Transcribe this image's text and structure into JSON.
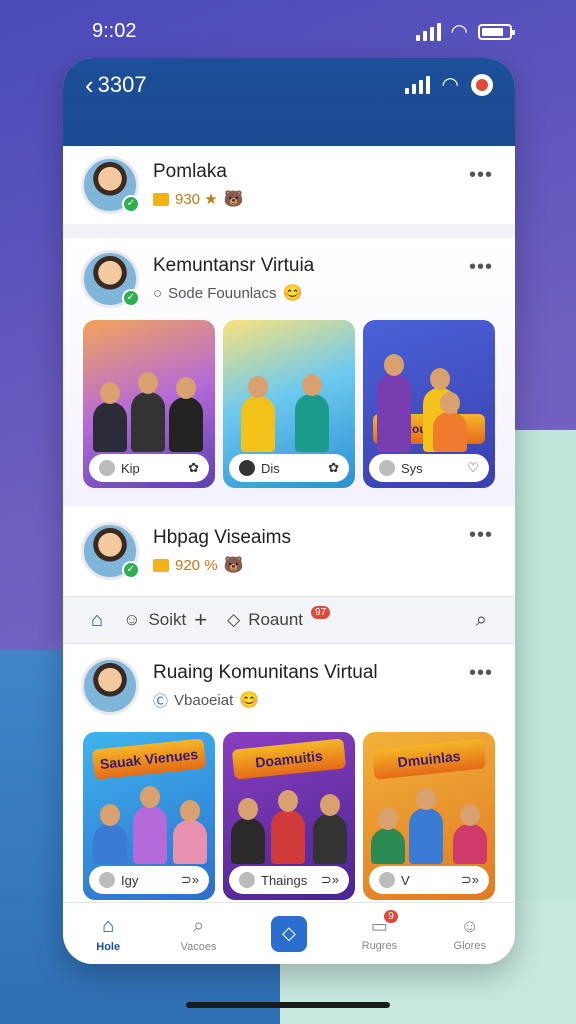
{
  "os": {
    "time": "9::02"
  },
  "header": {
    "back_label": "3307"
  },
  "post1": {
    "name": "Pomlaka",
    "stat": "930 ★"
  },
  "post2": {
    "name": "Kemuntansr Virtuia",
    "sub": "Sode Fouunlacs",
    "thumbs": [
      {
        "label": "Kip",
        "title": "",
        "bg": "#7b5bd6"
      },
      {
        "label": "Dis",
        "title": "",
        "bg": "#3fb4e0"
      },
      {
        "label": "Sys",
        "title": "Rounosa",
        "bg": "#3c3fb0"
      }
    ]
  },
  "post3": {
    "name": "Hbpag Viseaims",
    "stat": "920 %"
  },
  "strip": {
    "item1": "Soikt",
    "item2": "Roaunt",
    "badge": "97"
  },
  "post4": {
    "name": "Ruaing Komunitans Virtual",
    "sub": "Vbaoeiat",
    "thumbs": [
      {
        "label": "Igy",
        "title": "Sauak Vienues",
        "bg": "#2d7ad6"
      },
      {
        "label": "Thaings",
        "title": "Doamuitis",
        "bg": "#6a2fa3"
      },
      {
        "label": "V",
        "title": "Dmuinlas",
        "bg": "#e08a2b"
      }
    ]
  },
  "nav": {
    "home": "Hole",
    "search": "Vacoes",
    "messages": "Rugres",
    "profile": "Glores",
    "messages_badge": "9"
  },
  "colors": {
    "header": "#1d4f9a",
    "accent": "#2a6fd0",
    "notif": "#e04a3a"
  }
}
